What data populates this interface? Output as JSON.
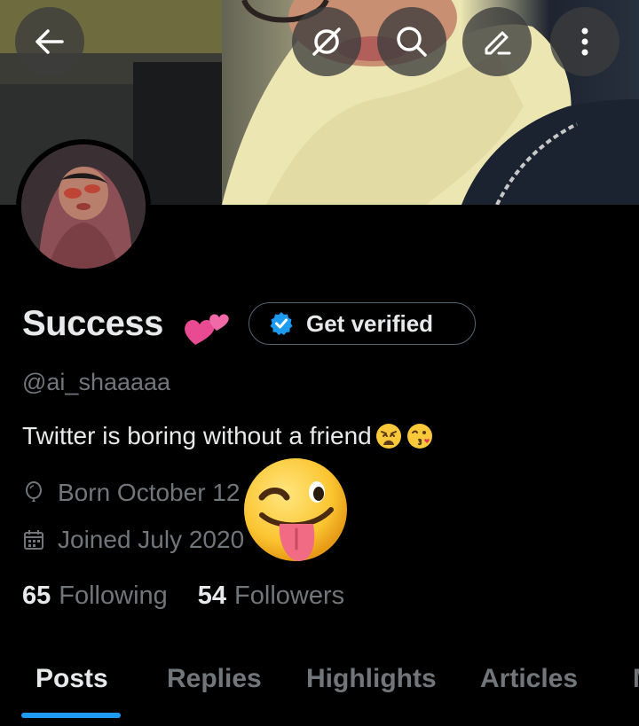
{
  "header": {
    "back_icon": "arrow-left-icon",
    "grok_icon": "grok-icon",
    "search_icon": "search-icon",
    "edit_icon": "edit-icon",
    "more_icon": "more-vertical-icon"
  },
  "profile": {
    "name": "Success",
    "name_emoji": "💕",
    "verify_label": "Get verified",
    "handle": "@ai_shaaaaa",
    "bio": "Twitter is boring without a friend",
    "bio_emojis": [
      "😩",
      "😘"
    ],
    "born": "Born October 12",
    "joined": "Joined July 2020",
    "following_count": "65",
    "following_label": "Following",
    "followers_count": "54",
    "followers_label": "Followers",
    "overlay_emoji": "😜"
  },
  "tabs": [
    {
      "label": "Posts",
      "active": true
    },
    {
      "label": "Replies",
      "active": false
    },
    {
      "label": "Highlights",
      "active": false
    },
    {
      "label": "Articles",
      "active": false
    },
    {
      "label": "Media",
      "active": false
    }
  ],
  "colors": {
    "background": "#000000",
    "primary_text": "#e7e9ea",
    "secondary_text": "#71767b",
    "accent": "#1d9bf0",
    "border": "#536471"
  }
}
